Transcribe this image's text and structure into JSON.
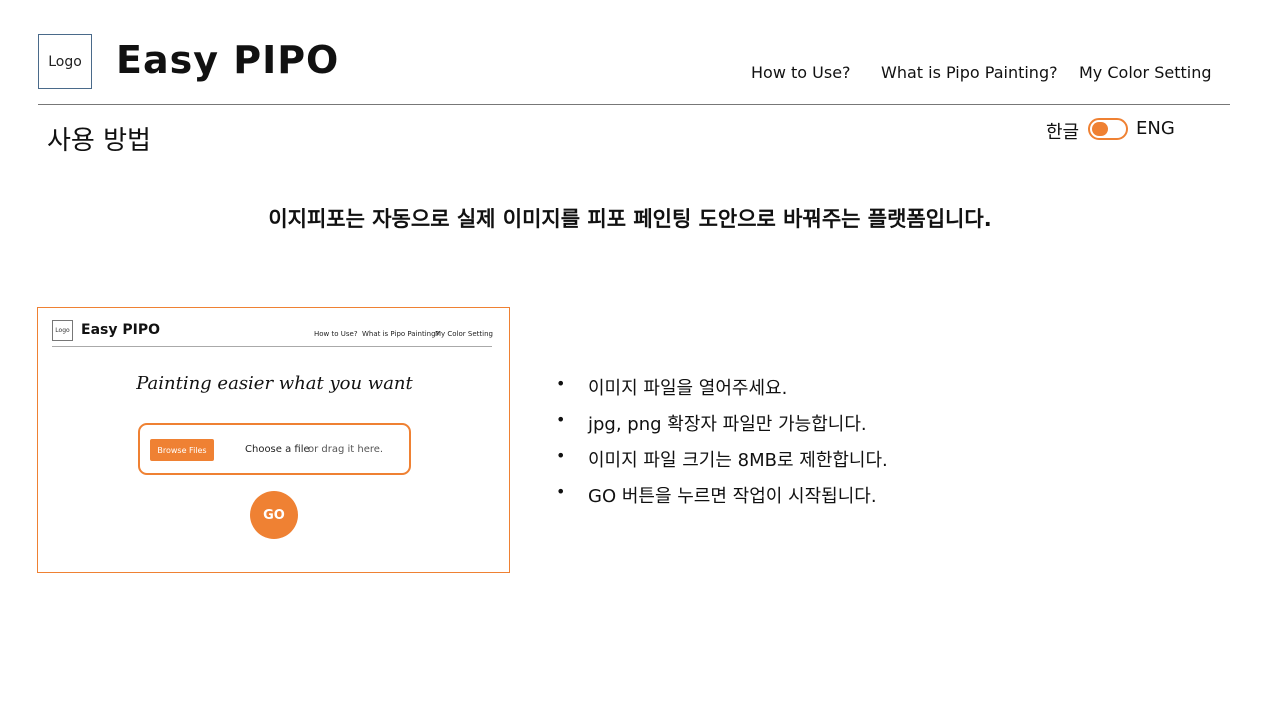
{
  "header": {
    "logo_text": "Logo",
    "brand": "Easy PIPO",
    "nav": [
      "How to Use?",
      "What is Pipo Painting?",
      "My Color Setting"
    ]
  },
  "page": {
    "title": "사용 방법",
    "subtitle": "이지피포는 자동으로 실제 이미지를 피포 페인팅 도안으로 바꿔주는 플랫폼입니다."
  },
  "language": {
    "korean_label": "한글",
    "english_label": "ENG",
    "active": "ENG"
  },
  "preview": {
    "logo_text": "Logo",
    "brand": "Easy PIPO",
    "nav": [
      "How to Use?",
      "What is Pipo Painting?",
      "My Color Setting"
    ],
    "tagline": "Painting easier what you want",
    "browse_label": "Browse Files",
    "choose_text": "Choose a file",
    "drag_text": "or  drag it here.",
    "go_label": "GO"
  },
  "instructions": [
    "이미지 파일을 열어주세요.",
    "jpg, png 확장자 파일만 가능합니다.",
    "이미지 파일 크기는 8MB로 제한합니다.",
    "GO 버튼을 누르면 작업이 시작됩니다."
  ],
  "bullet_symbol": "•",
  "colors": {
    "accent": "#ef8133",
    "divider": "#777777",
    "logo_border": "#4a6a8a"
  }
}
